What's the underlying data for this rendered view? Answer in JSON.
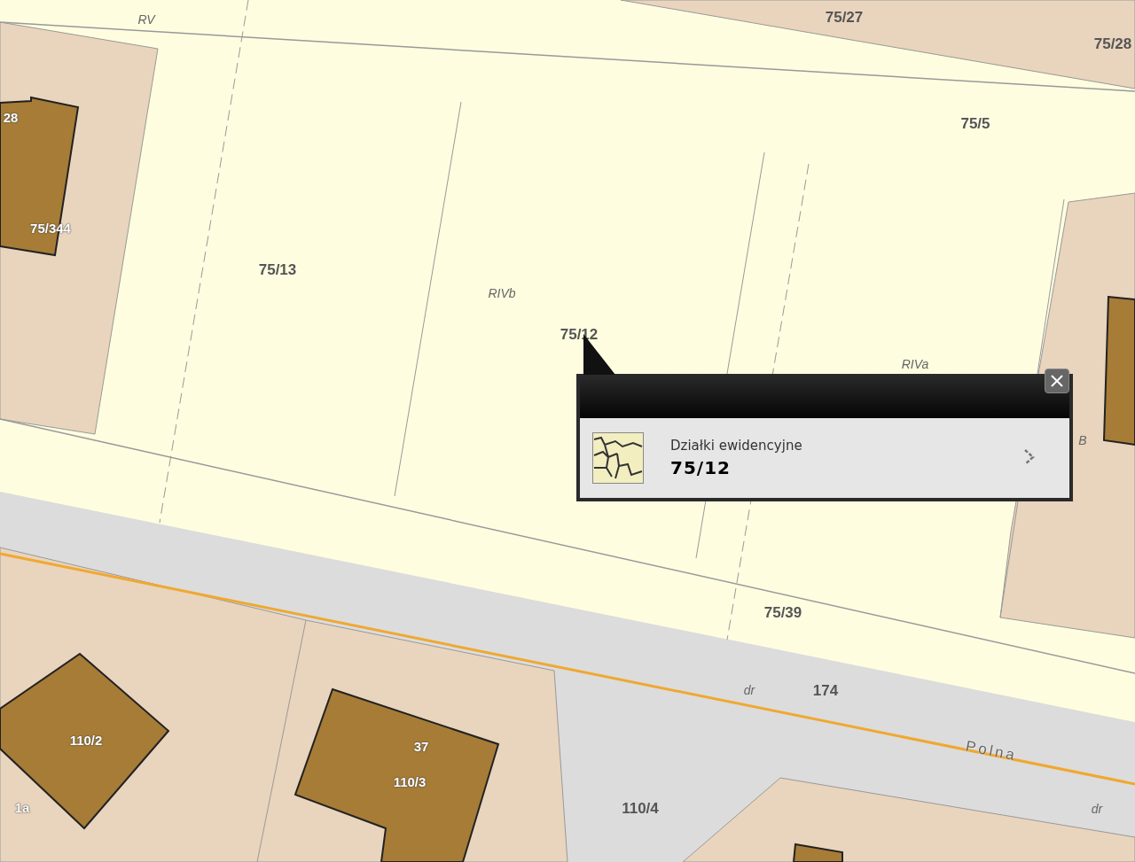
{
  "map_labels": [
    {
      "text": "RV",
      "kind": "land_class"
    },
    {
      "text": "75/27",
      "kind": "parcel"
    },
    {
      "text": "75/28",
      "kind": "parcel"
    },
    {
      "text": "75/5",
      "kind": "parcel"
    },
    {
      "text": "28",
      "kind": "building"
    },
    {
      "text": "75/344",
      "kind": "building"
    },
    {
      "text": "75/13",
      "kind": "parcel"
    },
    {
      "text": "RIVb",
      "kind": "land_class"
    },
    {
      "text": "75/12",
      "kind": "parcel"
    },
    {
      "text": "RIVa",
      "kind": "land_class"
    },
    {
      "text": "B",
      "kind": "land_class"
    },
    {
      "text": "75/39",
      "kind": "parcel"
    },
    {
      "text": "dr",
      "kind": "land_class"
    },
    {
      "text": "174",
      "kind": "parcel"
    },
    {
      "text": "Polna",
      "kind": "street"
    },
    {
      "text": "dr",
      "kind": "land_class"
    },
    {
      "text": "110/2",
      "kind": "building"
    },
    {
      "text": "37",
      "kind": "building"
    },
    {
      "text": "110/3",
      "kind": "building"
    },
    {
      "text": "1a",
      "kind": "building"
    },
    {
      "text": "110/4",
      "kind": "parcel"
    }
  ],
  "popup": {
    "layer": "Działki ewidencyjne",
    "parcel": "75/12"
  }
}
